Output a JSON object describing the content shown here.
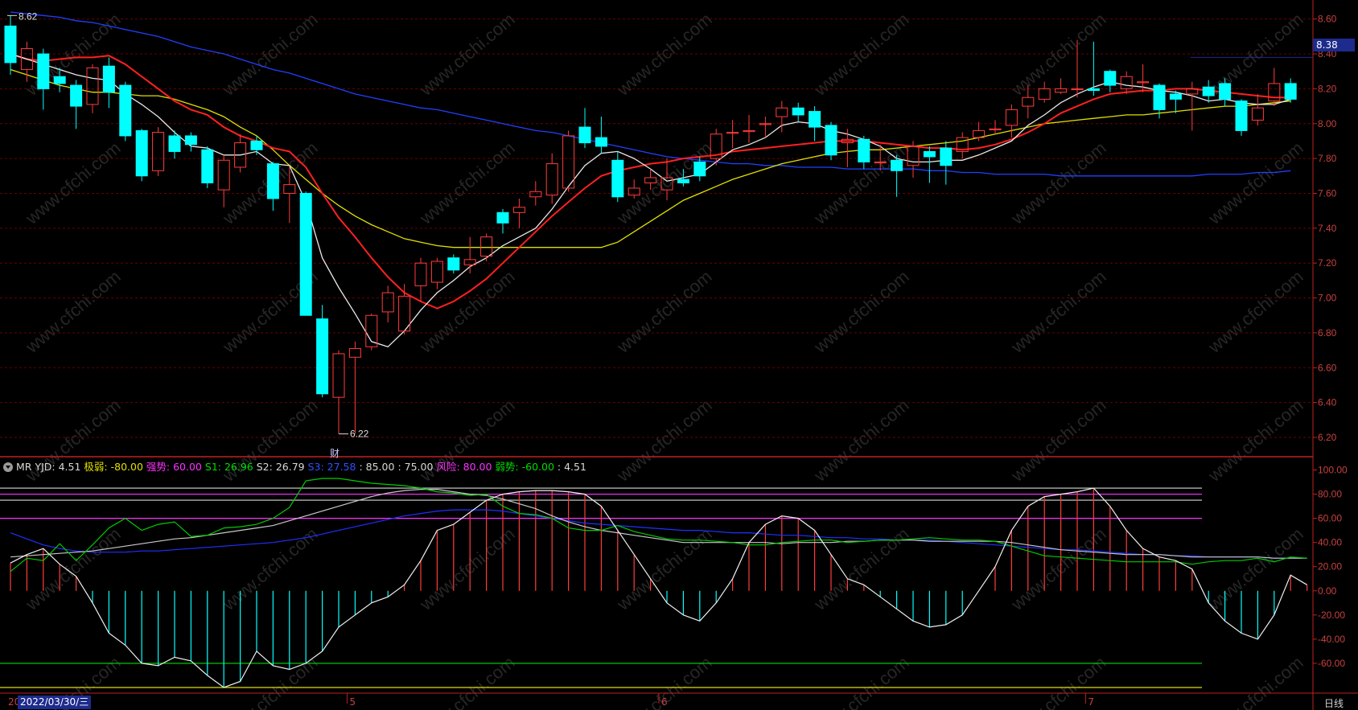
{
  "colors": {
    "up": "#ff3c3c",
    "down": "#00ffff",
    "ma5": "#e8e8e8",
    "ma10": "#ff2020",
    "ma20": "#e0e000",
    "ma60": "#2040ff",
    "grid": "#6a0000",
    "axis_red": "#c02020",
    "axis_text": "#c84040"
  },
  "chart_data": {
    "type": "candlestick",
    "price_axis": {
      "ticks": [
        "8.60",
        "8.40",
        "8.20",
        "8.00",
        "7.80",
        "7.60",
        "7.40",
        "7.20",
        "7.00",
        "6.80",
        "6.60",
        "6.40",
        "6.20"
      ],
      "range": [
        6.14,
        8.64
      ]
    },
    "indicator_axis": {
      "ticks": [
        "100.00",
        "80.00",
        "60.00",
        "40.00",
        "20.00",
        "0.00",
        "-20.00",
        "-40.00",
        "-60.00"
      ],
      "range": [
        -82,
        103
      ]
    },
    "extremes": {
      "high_label": "8.62",
      "low_label": "6.22",
      "current_price": "8.38"
    },
    "financial_marker": "财",
    "candles": [
      {
        "o": 8.56,
        "c": 8.35,
        "h": 8.62,
        "l": 8.28
      },
      {
        "o": 8.31,
        "c": 8.43,
        "h": 8.47,
        "l": 8.24
      },
      {
        "o": 8.4,
        "c": 8.2,
        "h": 8.43,
        "l": 8.08
      },
      {
        "o": 8.27,
        "c": 8.23,
        "h": 8.32,
        "l": 8.18
      },
      {
        "o": 8.22,
        "c": 8.1,
        "h": 8.25,
        "l": 7.97
      },
      {
        "o": 8.11,
        "c": 8.32,
        "h": 8.34,
        "l": 8.06
      },
      {
        "o": 8.33,
        "c": 8.18,
        "h": 8.38,
        "l": 8.09
      },
      {
        "o": 8.22,
        "c": 7.93,
        "h": 8.24,
        "l": 7.9
      },
      {
        "o": 7.96,
        "c": 7.7,
        "h": 7.97,
        "l": 7.67
      },
      {
        "o": 7.73,
        "c": 7.95,
        "h": 7.98,
        "l": 7.7
      },
      {
        "o": 7.93,
        "c": 7.84,
        "h": 7.96,
        "l": 7.8
      },
      {
        "o": 7.93,
        "c": 7.88,
        "h": 7.95,
        "l": 7.84
      },
      {
        "o": 7.85,
        "c": 7.66,
        "h": 7.87,
        "l": 7.63
      },
      {
        "o": 7.62,
        "c": 7.79,
        "h": 7.82,
        "l": 7.52
      },
      {
        "o": 7.75,
        "c": 7.89,
        "h": 7.94,
        "l": 7.72
      },
      {
        "o": 7.9,
        "c": 7.85,
        "h": 7.93,
        "l": 7.82
      },
      {
        "o": 7.77,
        "c": 7.57,
        "h": 7.78,
        "l": 7.5
      },
      {
        "o": 7.6,
        "c": 7.65,
        "h": 7.75,
        "l": 7.43
      },
      {
        "o": 7.6,
        "c": 6.9,
        "h": 7.61,
        "l": 6.9
      },
      {
        "o": 6.88,
        "c": 6.45,
        "h": 6.96,
        "l": 6.43
      },
      {
        "o": 6.43,
        "c": 6.68,
        "h": 6.7,
        "l": 6.22
      },
      {
        "o": 6.66,
        "c": 6.71,
        "h": 6.75,
        "l": 6.22
      },
      {
        "o": 6.72,
        "c": 6.9,
        "h": 6.91,
        "l": 6.7
      },
      {
        "o": 6.92,
        "c": 7.03,
        "h": 7.07,
        "l": 6.86
      },
      {
        "o": 6.81,
        "c": 7.01,
        "h": 7.08,
        "l": 6.79
      },
      {
        "o": 7.07,
        "c": 7.2,
        "h": 7.23,
        "l": 6.98
      },
      {
        "o": 7.09,
        "c": 7.21,
        "h": 7.23,
        "l": 7.05
      },
      {
        "o": 7.23,
        "c": 7.16,
        "h": 7.25,
        "l": 7.14
      },
      {
        "o": 7.19,
        "c": 7.22,
        "h": 7.35,
        "l": 7.14
      },
      {
        "o": 7.24,
        "c": 7.35,
        "h": 7.37,
        "l": 7.21
      },
      {
        "o": 7.49,
        "c": 7.43,
        "h": 7.51,
        "l": 7.37
      },
      {
        "o": 7.49,
        "c": 7.52,
        "h": 7.57,
        "l": 7.4
      },
      {
        "o": 7.58,
        "c": 7.61,
        "h": 7.67,
        "l": 7.53
      },
      {
        "o": 7.59,
        "c": 7.77,
        "h": 7.83,
        "l": 7.54
      },
      {
        "o": 7.63,
        "c": 7.93,
        "h": 7.96,
        "l": 7.61
      },
      {
        "o": 7.98,
        "c": 7.89,
        "h": 8.09,
        "l": 7.86
      },
      {
        "o": 7.92,
        "c": 7.87,
        "h": 8.04,
        "l": 7.83
      },
      {
        "o": 7.79,
        "c": 7.58,
        "h": 7.84,
        "l": 7.55
      },
      {
        "o": 7.59,
        "c": 7.63,
        "h": 7.68,
        "l": 7.57
      },
      {
        "o": 7.66,
        "c": 7.69,
        "h": 7.74,
        "l": 7.62
      },
      {
        "o": 7.62,
        "c": 7.69,
        "h": 7.8,
        "l": 7.56
      },
      {
        "o": 7.68,
        "c": 7.66,
        "h": 7.74,
        "l": 7.64
      },
      {
        "o": 7.78,
        "c": 7.7,
        "h": 7.81,
        "l": 7.67
      },
      {
        "o": 7.8,
        "c": 7.94,
        "h": 7.97,
        "l": 7.76
      },
      {
        "o": 7.95,
        "c": 7.95,
        "h": 8.02,
        "l": 7.86
      },
      {
        "o": 7.96,
        "c": 7.96,
        "h": 8.05,
        "l": 7.89
      },
      {
        "o": 8.0,
        "c": 8.0,
        "h": 8.04,
        "l": 7.92
      },
      {
        "o": 8.04,
        "c": 8.09,
        "h": 8.13,
        "l": 7.95
      },
      {
        "o": 8.09,
        "c": 8.05,
        "h": 8.12,
        "l": 8.01
      },
      {
        "o": 8.07,
        "c": 7.98,
        "h": 8.1,
        "l": 7.9
      },
      {
        "o": 7.99,
        "c": 7.82,
        "h": 8.01,
        "l": 7.79
      },
      {
        "o": 7.89,
        "c": 7.91,
        "h": 7.97,
        "l": 7.75
      },
      {
        "o": 7.91,
        "c": 7.78,
        "h": 7.93,
        "l": 7.74
      },
      {
        "o": 7.78,
        "c": 7.78,
        "h": 7.88,
        "l": 7.73
      },
      {
        "o": 7.79,
        "c": 7.73,
        "h": 7.82,
        "l": 7.58
      },
      {
        "o": 7.76,
        "c": 7.87,
        "h": 7.9,
        "l": 7.69
      },
      {
        "o": 7.84,
        "c": 7.81,
        "h": 7.87,
        "l": 7.66
      },
      {
        "o": 7.86,
        "c": 7.76,
        "h": 7.9,
        "l": 7.65
      },
      {
        "o": 7.84,
        "c": 7.92,
        "h": 7.95,
        "l": 7.8
      },
      {
        "o": 7.92,
        "c": 7.96,
        "h": 8.01,
        "l": 7.9
      },
      {
        "o": 7.97,
        "c": 7.97,
        "h": 8.02,
        "l": 7.94
      },
      {
        "o": 7.99,
        "c": 8.08,
        "h": 8.11,
        "l": 7.92
      },
      {
        "o": 8.1,
        "c": 8.15,
        "h": 8.22,
        "l": 8.03
      },
      {
        "o": 8.14,
        "c": 8.2,
        "h": 8.24,
        "l": 8.12
      },
      {
        "o": 8.18,
        "c": 8.2,
        "h": 8.26,
        "l": 8.17
      },
      {
        "o": 8.2,
        "c": 8.2,
        "h": 8.48,
        "l": 8.15
      },
      {
        "o": 8.2,
        "c": 8.19,
        "h": 8.47,
        "l": 8.16
      },
      {
        "o": 8.3,
        "c": 8.22,
        "h": 8.31,
        "l": 8.18
      },
      {
        "o": 8.2,
        "c": 8.27,
        "h": 8.3,
        "l": 8.17
      },
      {
        "o": 8.24,
        "c": 8.24,
        "h": 8.34,
        "l": 8.18
      },
      {
        "o": 8.22,
        "c": 8.08,
        "h": 8.23,
        "l": 8.03
      },
      {
        "o": 8.17,
        "c": 8.14,
        "h": 8.19,
        "l": 8.06
      },
      {
        "o": 8.17,
        "c": 8.2,
        "h": 8.24,
        "l": 7.96
      },
      {
        "o": 8.21,
        "c": 8.16,
        "h": 8.25,
        "l": 8.12
      },
      {
        "o": 8.23,
        "c": 8.14,
        "h": 8.26,
        "l": 8.1
      },
      {
        "o": 8.13,
        "c": 7.96,
        "h": 8.14,
        "l": 7.93
      },
      {
        "o": 8.02,
        "c": 8.09,
        "h": 8.17,
        "l": 7.99
      },
      {
        "o": 8.13,
        "c": 8.23,
        "h": 8.32,
        "l": 8.1
      },
      {
        "o": 8.23,
        "c": 8.14,
        "h": 8.26,
        "l": 8.12
      }
    ],
    "ma5": [
      8.4,
      8.37,
      8.34,
      8.31,
      8.28,
      8.26,
      8.25,
      8.17,
      8.11,
      8.04,
      7.95,
      7.87,
      7.86,
      7.82,
      7.82,
      7.84,
      7.77,
      7.76,
      7.55,
      7.23,
      7.06,
      6.91,
      6.75,
      6.72,
      6.81,
      6.93,
      7.03,
      7.1,
      7.18,
      7.23,
      7.3,
      7.35,
      7.4,
      7.51,
      7.64,
      7.76,
      7.83,
      7.84,
      7.8,
      7.74,
      7.67,
      7.69,
      7.71,
      7.78,
      7.85,
      7.88,
      7.92,
      7.99,
      8.01,
      8.0,
      7.96,
      7.94,
      7.91,
      7.87,
      7.8,
      7.78,
      7.78,
      7.79,
      7.79,
      7.82,
      7.86,
      7.9,
      7.99,
      8.05,
      8.12,
      8.17,
      8.21,
      8.24,
      8.22,
      8.21,
      8.19,
      8.18,
      8.16,
      8.13,
      8.14,
      8.12,
      8.11,
      8.11,
      8.14
    ],
    "ma10": [
      8.4,
      8.37,
      8.36,
      8.37,
      8.38,
      8.38,
      8.39,
      8.34,
      8.27,
      8.2,
      8.13,
      8.08,
      8.05,
      7.98,
      7.93,
      7.9,
      7.86,
      7.84,
      7.75,
      7.6,
      7.46,
      7.35,
      7.23,
      7.12,
      7.03,
      6.98,
      6.94,
      6.98,
      7.04,
      7.11,
      7.2,
      7.29,
      7.38,
      7.47,
      7.55,
      7.63,
      7.7,
      7.73,
      7.75,
      7.77,
      7.78,
      7.8,
      7.81,
      7.82,
      7.84,
      7.85,
      7.86,
      7.87,
      7.88,
      7.89,
      7.9,
      7.9,
      7.9,
      7.89,
      7.88,
      7.87,
      7.86,
      7.86,
      7.85,
      7.86,
      7.88,
      7.91,
      7.95,
      8.0,
      8.06,
      8.1,
      8.14,
      8.17,
      8.18,
      8.19,
      8.19,
      8.2,
      8.2,
      8.19,
      8.18,
      8.17,
      8.16,
      8.15,
      8.15
    ],
    "ma20": [
      8.31,
      8.28,
      8.25,
      8.22,
      8.2,
      8.18,
      8.18,
      8.17,
      8.16,
      8.16,
      8.14,
      8.11,
      8.08,
      8.04,
      7.98,
      7.93,
      7.85,
      7.76,
      7.68,
      7.6,
      7.53,
      7.47,
      7.42,
      7.38,
      7.34,
      7.32,
      7.3,
      7.29,
      7.29,
      7.29,
      7.29,
      7.29,
      7.29,
      7.29,
      7.29,
      7.29,
      7.29,
      7.32,
      7.38,
      7.44,
      7.5,
      7.56,
      7.6,
      7.64,
      7.68,
      7.71,
      7.74,
      7.77,
      7.79,
      7.81,
      7.83,
      7.84,
      7.85,
      7.85,
      7.86,
      7.87,
      7.88,
      7.89,
      7.9,
      7.92,
      7.94,
      7.96,
      7.98,
      8.0,
      8.01,
      8.02,
      8.03,
      8.04,
      8.05,
      8.05,
      8.06,
      8.07,
      8.08,
      8.09,
      8.1,
      8.1,
      8.11,
      8.12,
      8.13
    ],
    "ma60": [
      8.64,
      8.63,
      8.62,
      8.61,
      8.59,
      8.58,
      8.56,
      8.54,
      8.52,
      8.5,
      8.47,
      8.44,
      8.42,
      8.4,
      8.37,
      8.34,
      8.31,
      8.29,
      8.26,
      8.23,
      8.2,
      8.17,
      8.15,
      8.13,
      8.11,
      8.09,
      8.08,
      8.06,
      8.04,
      8.02,
      8.0,
      7.98,
      7.96,
      7.95,
      7.93,
      7.91,
      7.89,
      7.87,
      7.85,
      7.83,
      7.81,
      7.8,
      7.79,
      7.78,
      7.77,
      7.77,
      7.76,
      7.76,
      7.75,
      7.75,
      7.75,
      7.74,
      7.74,
      7.74,
      7.74,
      7.74,
      7.73,
      7.73,
      7.72,
      7.72,
      7.71,
      7.71,
      7.71,
      7.71,
      7.7,
      7.7,
      7.7,
      7.7,
      7.7,
      7.7,
      7.7,
      7.7,
      7.7,
      7.71,
      7.71,
      7.71,
      7.72,
      7.72,
      7.73
    ],
    "mr_series": {
      "yjd": [
        23,
        30,
        35,
        22,
        12,
        -10,
        -35,
        -45,
        -60,
        -62,
        -55,
        -58,
        -70,
        -80,
        -75,
        -50,
        -62,
        -65,
        -60,
        -50,
        -30,
        -20,
        -10,
        -5,
        5,
        25,
        50,
        55,
        65,
        75,
        80,
        82,
        83,
        83,
        82,
        80,
        70,
        50,
        30,
        10,
        -10,
        -20,
        -25,
        -10,
        10,
        40,
        55,
        62,
        60,
        50,
        30,
        10,
        5,
        -5,
        -15,
        -25,
        -30,
        -28,
        -20,
        0,
        20,
        50,
        70,
        78,
        80,
        82,
        85,
        70,
        50,
        35,
        28,
        25,
        18,
        -10,
        -25,
        -35,
        -40,
        -20,
        13,
        5
      ],
      "s1": [
        16,
        27,
        25,
        39,
        25,
        38,
        52,
        60,
        50,
        55,
        57,
        45,
        46,
        52,
        53,
        55,
        60,
        69,
        91,
        93,
        93,
        91,
        89,
        88,
        87,
        85,
        82,
        81,
        79,
        80,
        70,
        64,
        63,
        60,
        52,
        50,
        50,
        54,
        49,
        46,
        43,
        42,
        42,
        41,
        40,
        38,
        38,
        40,
        41,
        42,
        42,
        40,
        41,
        42,
        42,
        43,
        44,
        43,
        42,
        42,
        41,
        37,
        33,
        29,
        28,
        27,
        26,
        25,
        24,
        24,
        24,
        24,
        22,
        24,
        25,
        25,
        27,
        24,
        28,
        27
      ],
      "s2": [
        28,
        29,
        30,
        31,
        32,
        33,
        35,
        37,
        39,
        41,
        43,
        44,
        46,
        48,
        50,
        52,
        54,
        58,
        62,
        66,
        70,
        74,
        78,
        81,
        83,
        84,
        84,
        82,
        80,
        79,
        76,
        72,
        68,
        62,
        57,
        53,
        50,
        48,
        46,
        44,
        42,
        40,
        40,
        40,
        40,
        40,
        40,
        39,
        40,
        40,
        40,
        41,
        41,
        42,
        42,
        42,
        41,
        41,
        41,
        41,
        41,
        40,
        38,
        36,
        34,
        33,
        32,
        31,
        30,
        30,
        30,
        29,
        28,
        28,
        28,
        28,
        28,
        27,
        27,
        27
      ],
      "s3": [
        48,
        43,
        38,
        35,
        33,
        32,
        32,
        32,
        33,
        33,
        34,
        35,
        36,
        37,
        38,
        39,
        40,
        42,
        44,
        47,
        50,
        53,
        56,
        59,
        62,
        64,
        66,
        67,
        67,
        67,
        66,
        64,
        62,
        60,
        58,
        56,
        55,
        54,
        53,
        52,
        51,
        50,
        50,
        49,
        48,
        48,
        47,
        46,
        46,
        45,
        44,
        44,
        43,
        43,
        42,
        42,
        42,
        41,
        40,
        39,
        38,
        37,
        36,
        35,
        34,
        34,
        33,
        32,
        31,
        30,
        30,
        29,
        29,
        28,
        28,
        28,
        28,
        27,
        27,
        27
      ]
    },
    "mr_levels": [
      {
        "name": "极弱",
        "value": -80,
        "color": "#e0e000"
      },
      {
        "name": "弱势",
        "value": -60,
        "color": "#00dd00"
      },
      {
        "name": "强势",
        "value": 60,
        "color": "#ff30ff"
      },
      {
        "name": "",
        "value": 75,
        "color": "#d8d8d8"
      },
      {
        "name": "风险",
        "value": 80,
        "color": "#ff30ff"
      },
      {
        "name": "",
        "value": 85,
        "color": "#d8d8d8"
      }
    ]
  },
  "indicator_legend": {
    "icon": "dropdown-icon",
    "items": [
      {
        "text": "MR YJD: 4.51",
        "color": "#d8d8d8"
      },
      {
        "text": "极弱: -80.00",
        "color": "#e0e000"
      },
      {
        "text": "强势: 60.00",
        "color": "#ff30ff"
      },
      {
        "text": "S1: 26.96",
        "color": "#00dd00"
      },
      {
        "text": "S2: 26.79",
        "color": "#d8d8d8"
      },
      {
        "text": "S3: 27.58",
        "color": "#3050ff"
      },
      {
        "text": ": 85.00",
        "color": "#d8d8d8"
      },
      {
        "text": ": 75.00",
        "color": "#d8d8d8"
      },
      {
        "text": "风险: 80.00",
        "color": "#ff30ff"
      },
      {
        "text": "弱势: -60.00",
        "color": "#00dd00"
      },
      {
        "text": ": 4.51",
        "color": "#d8d8d8"
      }
    ]
  },
  "x_axis": {
    "left_label": "20",
    "date_cursor": "2022/03/30/三",
    "months": [
      {
        "label": "5",
        "index": 21
      },
      {
        "label": "6",
        "index": 40
      },
      {
        "label": "7",
        "index": 66
      }
    ],
    "period": "日线"
  },
  "watermark": "www.cfchi.com"
}
